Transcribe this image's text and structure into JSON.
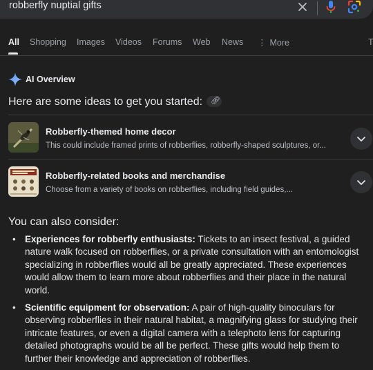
{
  "search": {
    "query": "robberfly nuptial gifts"
  },
  "tabs": [
    {
      "label": "All"
    },
    {
      "label": "Shopping"
    },
    {
      "label": "Images"
    },
    {
      "label": "Videos"
    },
    {
      "label": "Forums"
    },
    {
      "label": "Web"
    },
    {
      "label": "News"
    },
    {
      "label": "More"
    },
    {
      "label": "T"
    }
  ],
  "ai_overview": {
    "title": "AI Overview",
    "intro": "Here are some ideas to get you started:",
    "cards": [
      {
        "title": "Robberfly-themed home decor",
        "description": "This could include framed prints of robberflies, robberfly-shaped sculptures, or..."
      },
      {
        "title": "Robberfly-related books and merchandise",
        "description": "Choose from a variety of books on robberflies, including field guides,..."
      }
    ],
    "consider_heading": "You can also consider:",
    "bullets": [
      {
        "bold": "Experiences for robberfly enthusiasts:",
        "text": " Tickets to an insect festival, a guided nature walk focused on robberflies, or a private consultation with an entomologist specializing in robberflies would all be greatly appreciated. These experiences would allow them to learn more about robberflies and their place in the natural world."
      },
      {
        "bold": "Scientific equipment for observation:",
        "text": " A pair of high-quality binoculars for observing robberflies in their natural habitat, a magnifying glass for studying their intricate features, or even a digital camera with a telephoto lens for capturing detailed photographs would be all be perfect. These gifts would help them to further their knowledge and appreciation of robberflies."
      }
    ]
  },
  "icons": {
    "clear": "close-icon",
    "mic": "mic-icon",
    "lens": "google-lens-icon",
    "sparkle": "ai-sparkle-icon",
    "link": "link-icon",
    "more": "more-vert-icon",
    "expand": "chevron-down-icon"
  },
  "colors": {
    "background": "#1f1f1f",
    "searchbar": "#303134",
    "sparkle": "#8ab4f8",
    "mic_blue": "#4285f4",
    "mic_red": "#ea4335"
  }
}
